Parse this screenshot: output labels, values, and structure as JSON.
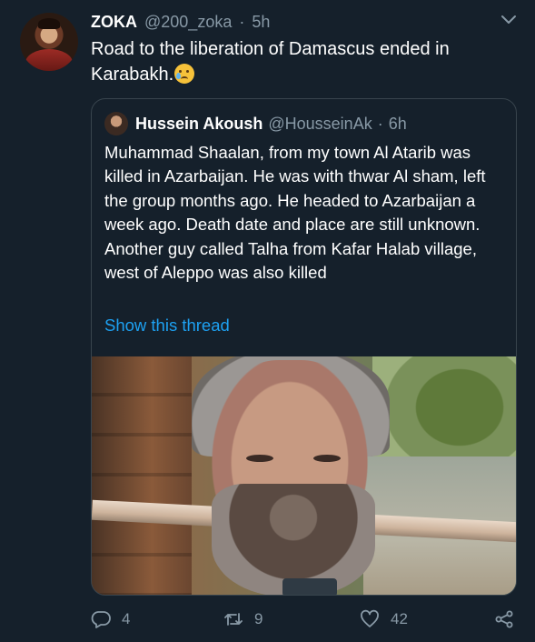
{
  "tweet": {
    "name": "ZOKA",
    "handle": "@200_zoka",
    "dot": "·",
    "time": "5h",
    "text": "Road to the liberation of Damascus ended in Karabakh."
  },
  "quoted": {
    "name": "Hussein Akoush",
    "handle": "@HousseinAk",
    "dot": "·",
    "time": "6h",
    "text": "Muhammad Shaalan, from my town Al Atarib was killed in Azarbaijan. He was with thwar Al sham, left the group months ago. He headed to Azarbaijan a week ago. Death date and place are still unknown. Another guy called Talha from Kafar Halab village, west of Aleppo was also killed",
    "show_thread": "Show this thread"
  },
  "actions": {
    "reply_count": "4",
    "retweet_count": "9",
    "like_count": "42"
  },
  "icons": {
    "caret": "chevron-down-icon",
    "reply": "reply-icon",
    "retweet": "retweet-icon",
    "like": "heart-icon",
    "share": "share-icon",
    "emoji": "crying-face-emoji"
  },
  "colors": {
    "background": "#15202b",
    "secondary_text": "#8899a6",
    "link": "#1da1f2",
    "border": "#38444d"
  }
}
